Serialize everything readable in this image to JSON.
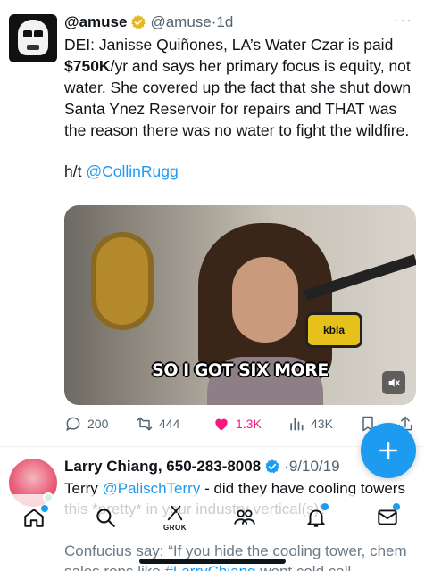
{
  "tweet1": {
    "display_name": "@amuse",
    "handle": "@amuse",
    "separator": "·",
    "age": "1d",
    "more": "···",
    "text_part1": "DEI: Janisse Quiñones, LA’s Water Czar is paid ",
    "text_bold": "$750K",
    "text_part2": "/yr and says her primary focus is equity, not water. She covered up the fact that she shut down Santa Ynez Reservoir for repairs and THAT was the reason there was no water to fight the wildfire.",
    "ht_prefix": "h/t ",
    "ht_mention": "@CollinRugg",
    "video_caption": "SO I GOT SIX MORE",
    "mic_label": "kbla",
    "replies": "200",
    "reposts": "444",
    "likes": "1.3K",
    "views": "43K"
  },
  "tweet2": {
    "display_name": "Larry Chiang, 650-283-8008",
    "separator": "·",
    "date": "9/10/19",
    "more": "···",
    "text_a": "Terry ",
    "mention1": "@PalischTerry",
    "text_b": " - did they have cooling towers this *pretty* in your industry vertical(s)?",
    "text_c": "Confucius say: “If you hide the cooling tower, chem sales reps like ",
    "mention2": "#LarryChiang",
    "text_d": " wont cold call"
  },
  "tabbar": {
    "grok_label": "GROK"
  },
  "colors": {
    "accent": "#1d9bf0",
    "like": "#f91880",
    "verified_gold": "#e8b623",
    "muted": "#536471"
  }
}
